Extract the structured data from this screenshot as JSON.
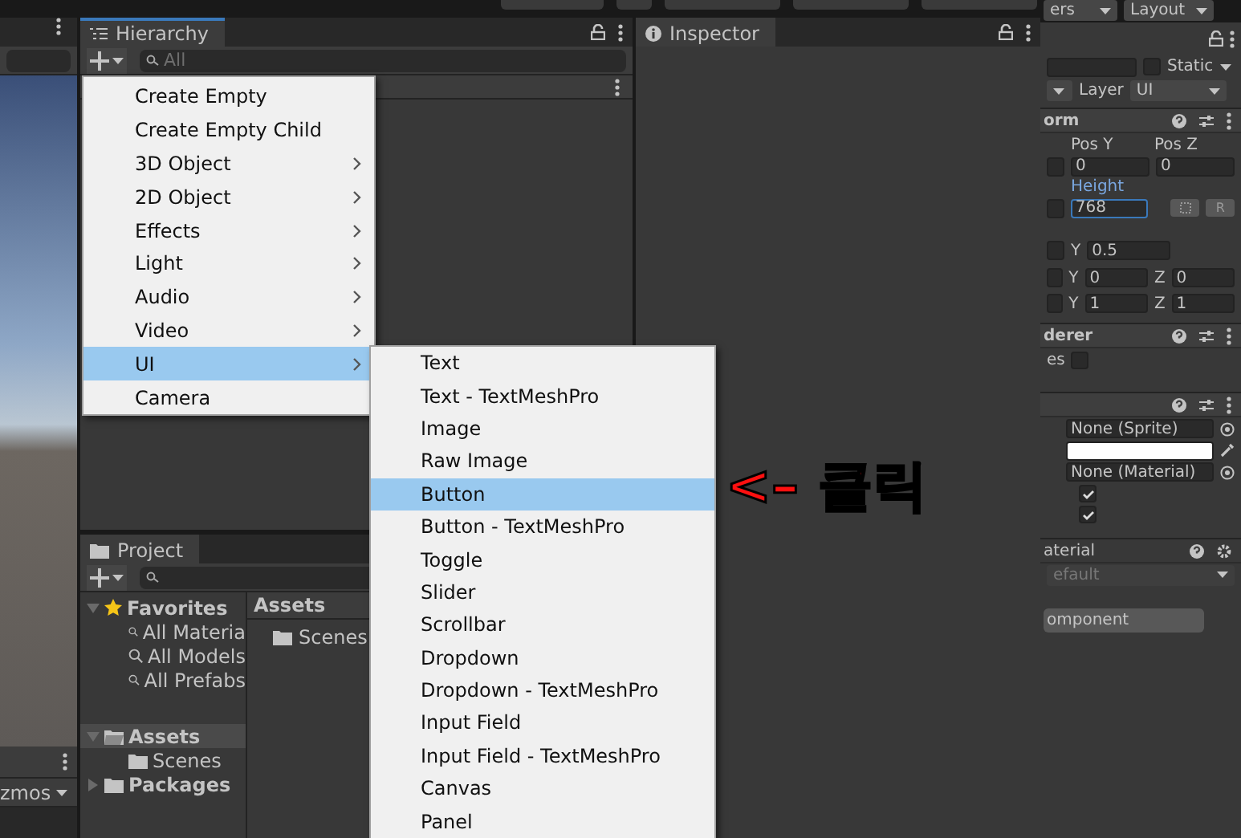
{
  "scene": {
    "toolbar_text": "zmos"
  },
  "hierarchy": {
    "title": "Hierarchy",
    "search_placeholder": "All"
  },
  "create_menu": {
    "items": [
      {
        "label": "Create Empty",
        "has_submenu": false,
        "selected": false
      },
      {
        "label": "Create Empty Child",
        "has_submenu": false,
        "selected": false
      },
      {
        "label": "3D Object",
        "has_submenu": true,
        "selected": false
      },
      {
        "label": "2D Object",
        "has_submenu": true,
        "selected": false
      },
      {
        "label": "Effects",
        "has_submenu": true,
        "selected": false
      },
      {
        "label": "Light",
        "has_submenu": true,
        "selected": false
      },
      {
        "label": "Audio",
        "has_submenu": true,
        "selected": false
      },
      {
        "label": "Video",
        "has_submenu": true,
        "selected": false
      },
      {
        "label": "UI",
        "has_submenu": true,
        "selected": true
      },
      {
        "label": "Camera",
        "has_submenu": false,
        "selected": false
      }
    ]
  },
  "ui_submenu": {
    "items": [
      {
        "label": "Text",
        "selected": false
      },
      {
        "label": "Text - TextMeshPro",
        "selected": false
      },
      {
        "label": "Image",
        "selected": false
      },
      {
        "label": "Raw Image",
        "selected": false
      },
      {
        "label": "Button",
        "selected": true
      },
      {
        "label": "Button - TextMeshPro",
        "selected": false
      },
      {
        "label": "Toggle",
        "selected": false
      },
      {
        "label": "Slider",
        "selected": false
      },
      {
        "label": "Scrollbar",
        "selected": false
      },
      {
        "label": "Dropdown",
        "selected": false
      },
      {
        "label": "Dropdown - TextMeshPro",
        "selected": false
      },
      {
        "label": "Input Field",
        "selected": false
      },
      {
        "label": "Input Field - TextMeshPro",
        "selected": false
      },
      {
        "label": "Canvas",
        "selected": false
      },
      {
        "label": "Panel",
        "selected": false
      }
    ]
  },
  "annotation": {
    "text": "<– 클릭"
  },
  "project": {
    "title": "Project",
    "tree": [
      {
        "label": "Favorites",
        "kind": "favorites",
        "expanded": true,
        "selected": false,
        "children": [
          {
            "label": "All Materia",
            "kind": "search"
          },
          {
            "label": "All Models",
            "kind": "search"
          },
          {
            "label": "All Prefabs",
            "kind": "search"
          }
        ]
      },
      {
        "label": "Assets",
        "kind": "folder",
        "expanded": true,
        "selected": true,
        "children": [
          {
            "label": "Scenes",
            "kind": "folder"
          }
        ]
      },
      {
        "label": "Packages",
        "kind": "folder",
        "expanded": false,
        "selected": false
      }
    ],
    "breadcrumb": "Assets",
    "files": [
      {
        "label": "Scenes"
      }
    ]
  },
  "inspector": {
    "title": "Inspector"
  },
  "right_inspector": {
    "toolbar": [
      {
        "label": "ers"
      },
      {
        "label": "Layout"
      }
    ],
    "static_label": "Static",
    "static_checked": false,
    "layer_label": "Layer",
    "layer_value": "UI",
    "transform": {
      "header": "orm",
      "col_labels": [
        "Pos Y",
        "Pos Z"
      ],
      "pos_values": [
        "0",
        "0"
      ],
      "height_label": "Height",
      "height_value": "768",
      "reset_label": "R",
      "rows": [
        [
          {
            "axis": "Y",
            "value": "0.5"
          }
        ],
        [
          {
            "axis": "Y",
            "value": "0"
          },
          {
            "axis": "Z",
            "value": "0"
          }
        ],
        [
          {
            "axis": "Y",
            "value": "1"
          },
          {
            "axis": "Z",
            "value": "1"
          }
        ]
      ]
    },
    "renderer": {
      "header": "derer",
      "row_label": "es",
      "checked": false
    },
    "image": {
      "sprite": "None (Sprite)",
      "material": "None (Material)",
      "checks": [
        true,
        true
      ]
    },
    "material": {
      "header": "aterial",
      "shader": "efault"
    },
    "add_component": "omponent"
  }
}
